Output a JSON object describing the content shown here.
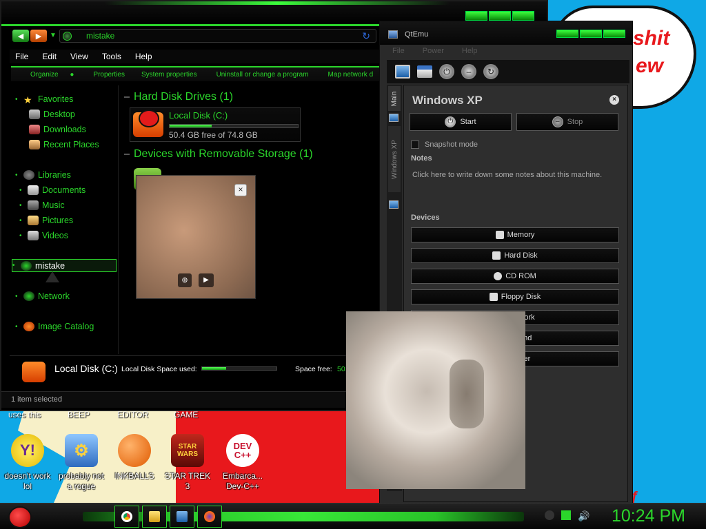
{
  "desktop": {
    "bubble_lines": [
      "shit",
      "ew"
    ],
    "top_captions": [
      "uses this",
      "BEEP",
      "EDITOR",
      "GAME"
    ],
    "icons": [
      {
        "label_line1": "doesn't work",
        "label_line2": "lol",
        "icon": "yahoo-messenger-icon"
      },
      {
        "label_line1": "probably not",
        "label_line2": "a rogue",
        "icon": "settings-gears-icon"
      },
      {
        "label_line1": "INKBALLS",
        "label_line2": "",
        "icon": "inkball-icon"
      },
      {
        "label_line1": "STAR TREK",
        "label_line2": "3",
        "icon": "star-trek-icon"
      },
      {
        "label_line1": "Embarca...",
        "label_line2": "Dev-C++",
        "icon": "dev-cpp-icon"
      }
    ],
    "dev_icon_text": "DEV C++"
  },
  "explorer": {
    "address": "mistake",
    "menu": [
      "File",
      "Edit",
      "View",
      "Tools",
      "Help"
    ],
    "commands": [
      "Organize",
      "Properties",
      "System properties",
      "Uninstall or change a program",
      "Map network d"
    ],
    "nav": {
      "favorites": "Favorites",
      "desktop": "Desktop",
      "downloads": "Downloads",
      "recent": "Recent Places",
      "libraries": "Libraries",
      "documents": "Documents",
      "music": "Music",
      "pictures": "Pictures",
      "videos": "Videos",
      "computer": "mistake",
      "network": "Network",
      "image_catalog": "Image Catalog"
    },
    "groups": {
      "hdd_header": "Hard Disk Drives (1)",
      "removable_header": "Devices with Removable Storage (1)"
    },
    "drive": {
      "name": "Local Disk (C:)",
      "free_text": "50.4 GB free of 74.8 GB",
      "used_fraction": 0.326
    },
    "details": {
      "name": "Local Disk (C:)",
      "used_label": "Local Disk Space used:",
      "free_label": "Space free:",
      "free_value": "50."
    },
    "status": "1 item selected"
  },
  "media_popup": {
    "close": "×"
  },
  "qtemu": {
    "title": "QtEmu",
    "menu": [
      "File",
      "Power",
      "Help"
    ],
    "tabs": [
      "Main",
      "Windows XP"
    ],
    "vm_name": "Windows XP",
    "start": "Start",
    "stop": "Stop",
    "snapshot": "Snapshot mode",
    "notes_header": "Notes",
    "notes_placeholder": "Click here to write down some notes about this machine.",
    "devices_header": "Devices",
    "devices": [
      "Memory",
      "Hard Disk",
      "CD ROM",
      "Floppy Disk",
      "Network",
      "Sound",
      "Other"
    ]
  },
  "taskbar": {
    "clock": "10:24 PM",
    "apps": [
      "chrome",
      "explorer",
      "qtemu",
      "firefox"
    ]
  }
}
